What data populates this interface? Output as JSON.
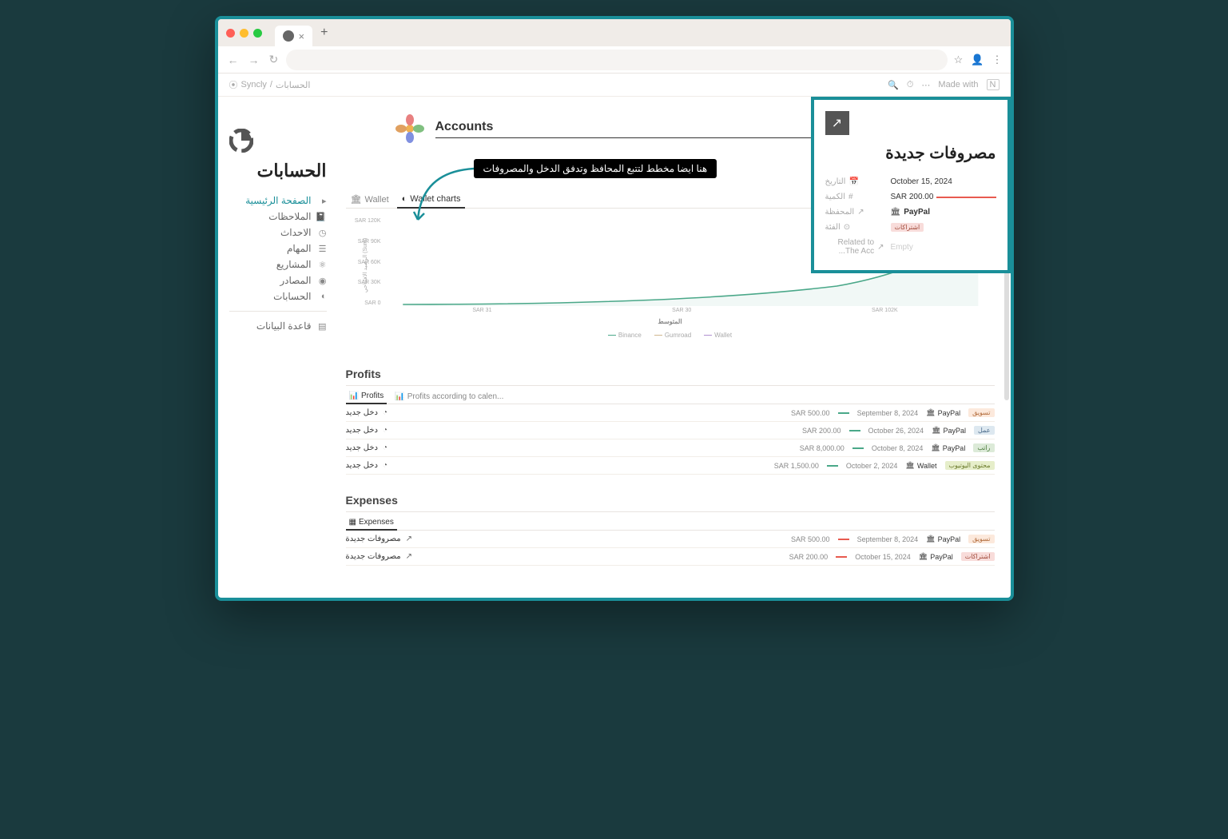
{
  "tab": {
    "close": "×",
    "new": "+"
  },
  "nav": {
    "back": "←",
    "forward": "→",
    "reload": "↻"
  },
  "urlbar": {
    "star": "☆",
    "user": "👤",
    "menu": "⋮"
  },
  "breadcrumb": {
    "icon": "⦿",
    "root": "Syncly",
    "sep": "/",
    "current": "الحسابات"
  },
  "topIcons": {
    "search": "🔍",
    "clock": "⏱",
    "more": "⋯",
    "made": "Made with",
    "n": "N"
  },
  "sidebar": {
    "title": "الحسابات",
    "items": [
      {
        "label": "الصفحة الرئيسية",
        "icon": "▸"
      },
      {
        "label": "الملاحظات",
        "icon": "📓"
      },
      {
        "label": "الاحداث",
        "icon": "◷"
      },
      {
        "label": "المهام",
        "icon": "☰"
      },
      {
        "label": "المشاريع",
        "icon": "⚛"
      },
      {
        "label": "المصادر",
        "icon": "◉"
      },
      {
        "label": "الحسابات",
        "icon": "◐"
      }
    ],
    "footer": {
      "label": "قاعدة البيانات",
      "icon": "▤"
    }
  },
  "page": {
    "title": "Accounts"
  },
  "tooltip": "هنا ايضا مخطط لتتبع المحافظ وتدفق الدخل والمصروفات",
  "viewTabs": [
    {
      "label": "Wallet",
      "icon": "🏛"
    },
    {
      "label": "Wallet charts",
      "icon": "◐"
    }
  ],
  "chart": {
    "yLabels": [
      "SAR 120K",
      "SAR 90K",
      "SAR 60K",
      "SAR 30K",
      "SAR 0"
    ],
    "yAxisLabel": "الرصيد الافتتاحي (Sum)",
    "xLabels": [
      "SAR 31",
      "SAR 30",
      "SAR 102K"
    ],
    "xAxisLabel": "المتوسط",
    "legend": [
      {
        "label": "Binance",
        "color": "#4aa889"
      },
      {
        "label": "Gumroad",
        "color": "#d0b890"
      },
      {
        "label": "Wallet",
        "color": "#b090d0"
      }
    ]
  },
  "profits": {
    "title": "Profits",
    "tabs": [
      {
        "label": "Profits",
        "icon": "📊"
      },
      {
        "label": "Profits according to calen...",
        "icon": "📊"
      }
    ],
    "rows": [
      {
        "title": "دخل جديد",
        "icon": "◔",
        "amount": "SAR 500.00",
        "barColor": "#4aa889",
        "date": "September 8, 2024",
        "wallet": "PayPal",
        "tag": "تسويق",
        "tagClass": "orange"
      },
      {
        "title": "دخل جديد",
        "icon": "◔",
        "amount": "SAR 200.00",
        "barColor": "#4aa889",
        "date": "October 26, 2024",
        "wallet": "PayPal",
        "tag": "عمل",
        "tagClass": "blue"
      },
      {
        "title": "دخل جديد",
        "icon": "◔",
        "amount": "SAR 8,000.00",
        "barColor": "#4aa889",
        "date": "October 8, 2024",
        "wallet": "PayPal",
        "tag": "راتب",
        "tagClass": "green"
      },
      {
        "title": "دخل جديد",
        "icon": "◔",
        "amount": "SAR 1,500.00",
        "barColor": "#4aa889",
        "date": "October 2, 2024",
        "wallet": "Wallet",
        "tag": "محتوى اليوتيوب",
        "tagClass": "lime"
      }
    ]
  },
  "expenses": {
    "title": "Expenses",
    "tabs": [
      {
        "label": "Expenses",
        "icon": "▦"
      }
    ],
    "rows": [
      {
        "title": "مصروفات جديدة",
        "icon": "↗",
        "amount": "SAR 500.00",
        "barColor": "#e85a4f",
        "date": "September 8, 2024",
        "wallet": "PayPal",
        "tag": "تسويق",
        "tagClass": "orange"
      },
      {
        "title": "مصروفات جديدة",
        "icon": "↗",
        "amount": "SAR 200.00",
        "barColor": "#e85a4f",
        "date": "October 15, 2024",
        "wallet": "PayPal",
        "tag": "اشتراكات",
        "tagClass": "red"
      }
    ]
  },
  "popup": {
    "title": "مصروفات جديدة",
    "icon": "↗",
    "rows": [
      {
        "icon": "📅",
        "label": "التاريخ",
        "value": "October 15, 2024",
        "type": "text"
      },
      {
        "icon": "#",
        "label": "الكمية",
        "value": "SAR 200.00",
        "type": "amount-red"
      },
      {
        "icon": "↗",
        "label": "المحفظة",
        "value": "PayPal",
        "type": "wallet"
      },
      {
        "icon": "⊙",
        "label": "الفئة",
        "value": "اشتراكات",
        "type": "tag"
      },
      {
        "icon": "↗",
        "label": "Related to The Acc...",
        "value": "Empty",
        "type": "empty"
      }
    ]
  },
  "chart_data": {
    "type": "line",
    "title": "Wallet charts",
    "ylabel": "الرصيد الافتتاحي (Sum)",
    "xlabel": "المتوسط",
    "ylim": [
      0,
      120000
    ],
    "y_ticks": [
      0,
      30000,
      60000,
      90000,
      120000
    ],
    "x_categories": [
      "SAR 31",
      "SAR 30",
      "SAR 102K"
    ],
    "series": [
      {
        "name": "Binance",
        "color": "#4aa889",
        "values": [
          2000,
          8000,
          102000
        ]
      },
      {
        "name": "Gumroad",
        "color": "#d0b890",
        "values": [
          null,
          null,
          null
        ]
      },
      {
        "name": "Wallet",
        "color": "#b090d0",
        "values": [
          null,
          null,
          null
        ]
      }
    ]
  }
}
